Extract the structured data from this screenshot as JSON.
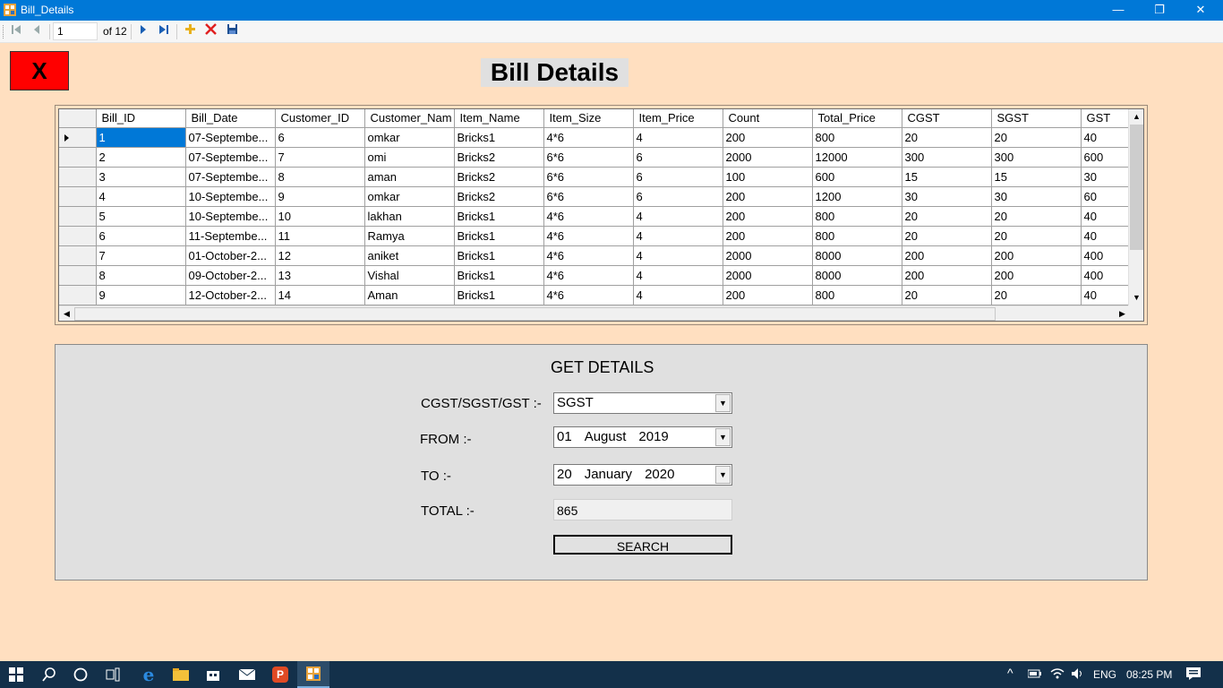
{
  "window": {
    "title": "Bill_Details",
    "controls": [
      "—",
      "❐",
      "✕"
    ]
  },
  "navigator": {
    "position": "1",
    "count_label": "of 12"
  },
  "close_button": {
    "label": "X"
  },
  "page_title": "Bill Details",
  "grid": {
    "columns": [
      "Bill_ID",
      "Bill_Date",
      "Customer_ID",
      "Customer_Nam",
      "Item_Name",
      "Item_Size",
      "Item_Price",
      "Count",
      "Total_Price",
      "CGST",
      "SGST",
      "GST"
    ],
    "rows": [
      [
        "1",
        "07-Septembe...",
        "6",
        " omkar",
        "Bricks1",
        "4*6",
        "4",
        "200",
        "800",
        "20",
        "20",
        "40"
      ],
      [
        "2",
        "07-Septembe...",
        "7",
        " omi",
        "Bricks2",
        "6*6",
        "6",
        "2000",
        "12000",
        "300",
        "300",
        "600"
      ],
      [
        "3",
        "07-Septembe...",
        "8",
        " aman",
        "Bricks2",
        "6*6",
        "6",
        "100",
        "600",
        "15",
        "15",
        "30"
      ],
      [
        "4",
        "10-Septembe...",
        "9",
        " omkar",
        "Bricks2",
        "6*6",
        "6",
        "200",
        "1200",
        "30",
        "30",
        "60"
      ],
      [
        "5",
        "10-Septembe...",
        "10",
        " lakhan",
        "Bricks1",
        "4*6",
        "4",
        "200",
        "800",
        "20",
        "20",
        "40"
      ],
      [
        "6",
        "11-Septembe...",
        "11",
        "Ramya",
        "Bricks1",
        "4*6",
        "4",
        "200",
        "800",
        "20",
        "20",
        "40"
      ],
      [
        "7",
        "01-October-2...",
        "12",
        " aniket",
        "Bricks1",
        "4*6",
        "4",
        "2000",
        "8000",
        "200",
        "200",
        "400"
      ],
      [
        "8",
        "09-October-2...",
        "13",
        " Vishal",
        "Bricks1",
        "4*6",
        "4",
        "2000",
        "8000",
        "200",
        "200",
        "400"
      ],
      [
        "9",
        "12-October-2...",
        "14",
        "Aman",
        "Bricks1",
        "4*6",
        "4",
        "200",
        "800",
        "20",
        "20",
        "40"
      ]
    ]
  },
  "details": {
    "title": "GET DETAILS",
    "tax_label": "CGST/SGST/GST :-",
    "tax_value": "SGST",
    "from_label": "FROM :-",
    "from_day": "01",
    "from_month": "August",
    "from_year": "2019",
    "to_label": "TO :-",
    "to_day": "20",
    "to_month": "January",
    "to_year": "2020",
    "total_label": "TOTAL :-",
    "total_value": "865",
    "search_label": "SEARCH"
  },
  "taskbar": {
    "lang": "ENG",
    "time": "08:25 PM"
  },
  "colors": {
    "form_background": "#FFDFC0",
    "titlebar": "#0078D7",
    "close_button": "#FF0000",
    "selection": "#0078D7",
    "taskbar": "#13304A"
  }
}
